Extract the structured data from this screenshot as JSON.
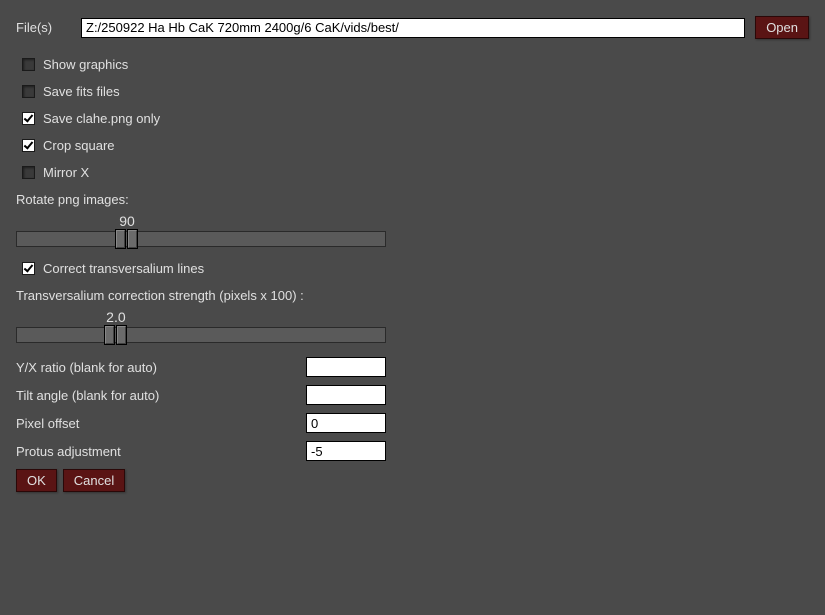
{
  "file": {
    "label": "File(s)",
    "value": "Z:/250922 Ha Hb CaK 720mm 2400g/6 CaK/vids/best/",
    "open_label": "Open"
  },
  "checks": {
    "show_graphics": {
      "label": "Show graphics",
      "checked": false
    },
    "save_fits": {
      "label": "Save fits files",
      "checked": false
    },
    "save_clahe": {
      "label": "Save clahe.png only",
      "checked": true
    },
    "crop_square": {
      "label": "Crop square",
      "checked": true
    },
    "mirror_x": {
      "label": "Mirror X",
      "checked": false
    },
    "correct_trans": {
      "label": "Correct transversalium lines",
      "checked": true
    }
  },
  "rotate": {
    "label": "Rotate png images:",
    "value": "90",
    "min": 0,
    "max": 360,
    "pos_pct": 30
  },
  "trans": {
    "label": "Transversalium correction strength (pixels x 100) :",
    "value": "2.0",
    "min": 0,
    "max": 10,
    "pos_pct": 27
  },
  "fields": {
    "yx_ratio": {
      "label": "Y/X ratio (blank for auto)",
      "value": ""
    },
    "tilt_angle": {
      "label": "Tilt angle (blank for auto)",
      "value": ""
    },
    "pixel_offset": {
      "label": "Pixel offset",
      "value": "0"
    },
    "protus": {
      "label": "Protus adjustment",
      "value": "-5"
    }
  },
  "footer": {
    "ok": "OK",
    "cancel": "Cancel"
  }
}
